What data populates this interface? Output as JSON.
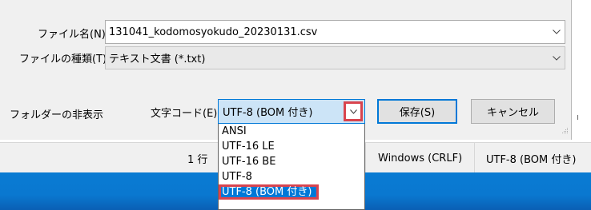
{
  "filename": {
    "label": "ファイル名(N):",
    "value": "131041_kodomosyokudo_20230131.csv"
  },
  "filetype": {
    "label": "ファイルの種類(T):",
    "value": "テキスト文書 (*.txt)"
  },
  "folder_toggle": {
    "label": "フォルダーの非表示"
  },
  "encoding": {
    "label": "文字コード(E):",
    "value": "UTF-8 (BOM 付き)",
    "options": [
      "ANSI",
      "UTF-16 LE",
      "UTF-16 BE",
      "UTF-8",
      "UTF-8 (BOM 付き)"
    ],
    "selected_option": "UTF-8 (BOM 付き)"
  },
  "buttons": {
    "save": "保存(S)",
    "cancel": "キャンセル"
  },
  "statusbar": {
    "position": "1 行",
    "line_ending": "Windows (CRLF)",
    "encoding": "UTF-8 (BOM 付き)"
  },
  "colors": {
    "highlight_red": "#d9444e",
    "selection_blue": "#0078d7",
    "taskbar_blue": "#0a7bd3"
  },
  "icons": {
    "dropdown": "chevron-down-icon",
    "resize": "resize-grip-icon"
  }
}
